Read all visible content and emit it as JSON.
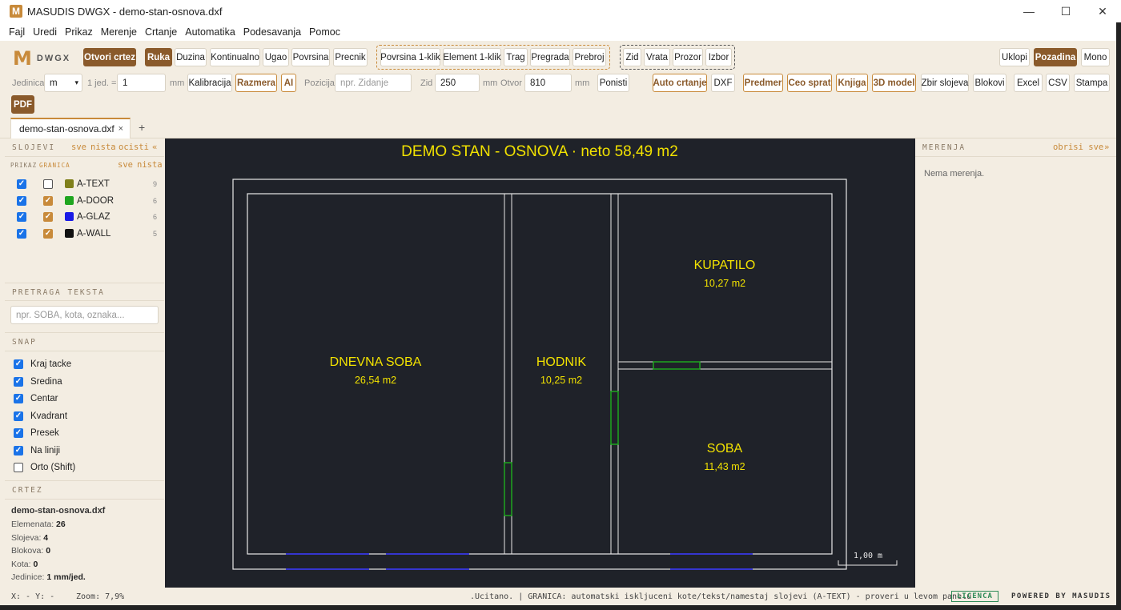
{
  "window": {
    "title": "MASUDIS DWGX - demo-stan-osnova.dxf",
    "logo_letter": "M",
    "controls": [
      "—",
      "☐",
      "✕"
    ]
  },
  "menu": [
    "Fajl",
    "Uredi",
    "Prikaz",
    "Merenje",
    "Crtanje",
    "Automatika",
    "Podesavanja",
    "Pomoc"
  ],
  "brand": {
    "letter": "M",
    "name": "DWGX"
  },
  "toolbar": {
    "open": "Otvori crtez",
    "draw_tools": [
      "Ruka",
      "Duzina",
      "Kontinualno",
      "Ugao",
      "Povrsina",
      "Precnik"
    ],
    "click_tools": [
      "Povrsina 1-klik",
      "Element 1-klik",
      "Trag",
      "Pregrada",
      "Prebroj"
    ],
    "object_tools": [
      "Zid",
      "Vrata",
      "Prozor",
      "Izbor"
    ],
    "view": [
      "Uklopi",
      "Pozadina",
      "Mono"
    ],
    "unit_label": "Jedinica",
    "unit_value": "m",
    "one_unit_label": "1 jed. =",
    "one_unit_value": "1",
    "mm": "mm",
    "calibration": "Kalibracija",
    "scale": "Razmera",
    "ai": "AI",
    "position_label": "Pozicija",
    "position_placeholder": "npr. Zidanje",
    "wall_label": "Zid",
    "wall_value": "250",
    "opening_label": "Otvor",
    "opening_value": "810",
    "cancel": "Ponisti",
    "auto": "Auto crtanje",
    "dxf": "DXF",
    "estimate": "Predmer",
    "whole_floor": "Ceo sprat",
    "book": "Knjiga",
    "model3d": "3D model",
    "layer_sum": "Zbir slojeva",
    "blocks": "Blokovi",
    "excel": "Excel",
    "csv": "CSV",
    "print": "Stampa",
    "pdf": "PDF"
  },
  "tabs": {
    "active": "demo-stan-osnova.dxf",
    "close": "×",
    "add": "+"
  },
  "layers": {
    "title": "SLOJEVI",
    "links": [
      "sve",
      "nista",
      "ocisti",
      "«"
    ],
    "sub_view": "PRIKAZ",
    "sub_border": "GRANICA",
    "sub_links": [
      "sve",
      "nista"
    ],
    "items": [
      {
        "name": "A-TEXT",
        "count": "9",
        "color": "#7f7f1a",
        "border": false
      },
      {
        "name": "A-DOOR",
        "count": "6",
        "color": "#1fa51f",
        "border": true
      },
      {
        "name": "A-GLAZ",
        "count": "6",
        "color": "#1a1ae6",
        "border": true
      },
      {
        "name": "A-WALL",
        "count": "5",
        "color": "#111111",
        "border": true
      }
    ]
  },
  "search": {
    "title": "PRETRAGA TEKSTA",
    "placeholder": "npr. SOBA, kota, oznaka..."
  },
  "snap": {
    "title": "SNAP",
    "items": [
      {
        "label": "Kraj tacke",
        "checked": true
      },
      {
        "label": "Sredina",
        "checked": true
      },
      {
        "label": "Centar",
        "checked": true
      },
      {
        "label": "Kvadrant",
        "checked": true
      },
      {
        "label": "Presek",
        "checked": true
      },
      {
        "label": "Na liniji",
        "checked": true
      },
      {
        "label": "Orto (Shift)",
        "checked": false
      }
    ]
  },
  "drawing": {
    "title": "CRTEZ",
    "file": "demo-stan-osnova.dxf",
    "rows": [
      {
        "label": "Elemenata:",
        "value": "26"
      },
      {
        "label": "Slojeva:",
        "value": "4"
      },
      {
        "label": "Blokova:",
        "value": "0"
      },
      {
        "label": "Kota:",
        "value": "0"
      },
      {
        "label": "Jedinice:",
        "value": "1 mm/jed."
      }
    ]
  },
  "plan": {
    "heading": "DEMO STAN - OSNOVA  ·  neto 58,49 m2",
    "rooms": [
      {
        "name": "DNEVNA SOBA",
        "area": "26,54 m2"
      },
      {
        "name": "HODNIK",
        "area": "10,25 m2"
      },
      {
        "name": "KUPATILO",
        "area": "10,27 m2"
      },
      {
        "name": "SOBA",
        "area": "11,43 m2"
      }
    ],
    "scale_bar": "1,00 m",
    "colors": {
      "background": "#1f2229",
      "wall": "#e8e8e8",
      "text": "#f2e200",
      "door": "#1fa51f",
      "glazing": "#3535d0"
    }
  },
  "measurements": {
    "title": "MERENJA",
    "clear": "obrisi sve",
    "collapse": "»",
    "empty": "Nema merenja."
  },
  "status": {
    "coords": "X: -  Y: -",
    "zoom": "Zoom: 7,9%",
    "message": ".Ucitano. | GRANICA: automatski iskljuceni kote/tekst/namestaj slojevi (A-TEXT) - proveri u levom panelu",
    "license": "LICENCA",
    "powered": "POWERED BY MASUDIS"
  },
  "accent": "#c88a3a"
}
